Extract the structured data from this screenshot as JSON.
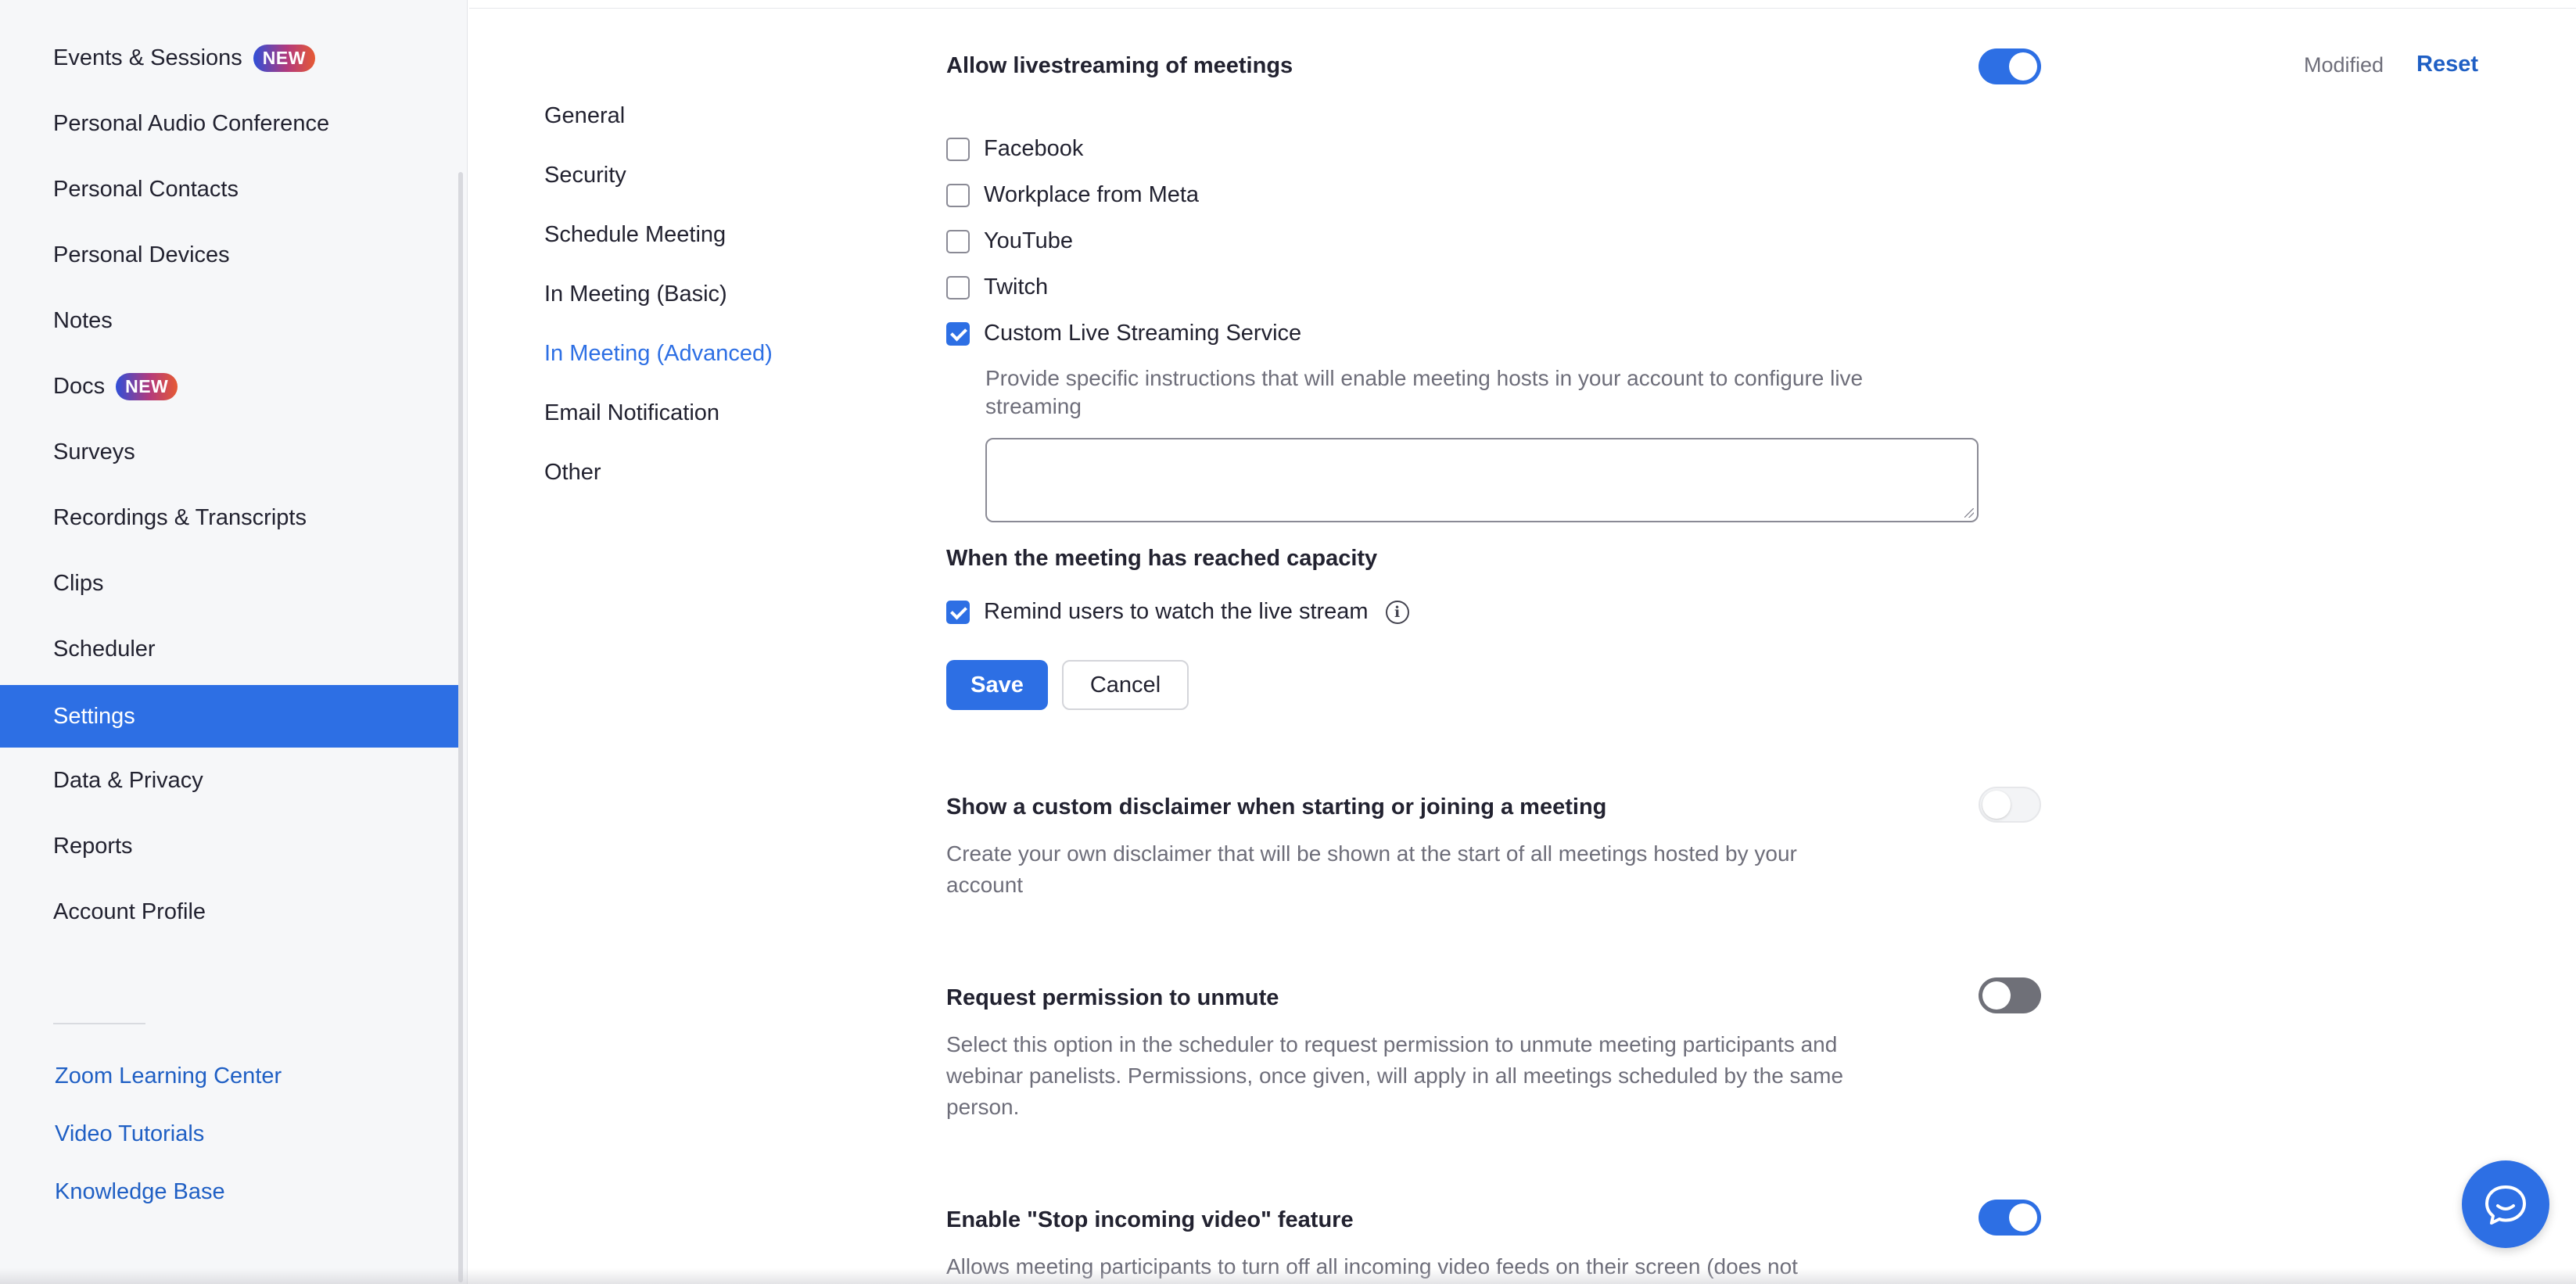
{
  "sidebar": {
    "items": [
      {
        "label": "Events & Sessions",
        "badge": "NEW"
      },
      {
        "label": "Personal Audio Conference"
      },
      {
        "label": "Personal Contacts"
      },
      {
        "label": "Personal Devices"
      },
      {
        "label": "Notes"
      },
      {
        "label": "Docs",
        "badge": "NEW"
      },
      {
        "label": "Surveys"
      },
      {
        "label": "Recordings & Transcripts"
      },
      {
        "label": "Clips"
      },
      {
        "label": "Scheduler"
      },
      {
        "label": "Settings",
        "active": true
      },
      {
        "label": "Data & Privacy"
      },
      {
        "label": "Reports"
      },
      {
        "label": "Account Profile"
      }
    ],
    "links": [
      "Zoom Learning Center",
      "Video Tutorials",
      "Knowledge Base"
    ]
  },
  "subnav": {
    "items": [
      "General",
      "Security",
      "Schedule Meeting",
      "In Meeting (Basic)",
      "In Meeting (Advanced)",
      "Email Notification",
      "Other"
    ],
    "active": "In Meeting (Advanced)"
  },
  "livestream": {
    "title": "Allow livestreaming of meetings",
    "toggle_on": true,
    "status": "Modified",
    "reset_label": "Reset",
    "options": [
      {
        "label": "Facebook",
        "checked": false
      },
      {
        "label": "Workplace from Meta",
        "checked": false
      },
      {
        "label": "YouTube",
        "checked": false
      },
      {
        "label": "Twitch",
        "checked": false
      },
      {
        "label": "Custom Live Streaming Service",
        "checked": true
      }
    ],
    "custom_instructions_l1": "Provide specific instructions that will enable meeting hosts in your account to configure live",
    "custom_instructions_l2": "streaming",
    "instructions_value": "",
    "capacity_title": "When the meeting has reached capacity",
    "remind_label": "Remind users to watch the live stream",
    "remind_checked": true,
    "save_label": "Save",
    "cancel_label": "Cancel"
  },
  "disclaimer": {
    "title": "Show a custom disclaimer when starting or joining a meeting",
    "desc_l1": "Create your own disclaimer that will be shown at the start of all meetings hosted by your",
    "desc_l2": "account",
    "toggle_on": false
  },
  "unmute": {
    "title": "Request permission to unmute",
    "desc_l1": "Select this option in the scheduler to request permission to unmute meeting participants and",
    "desc_l2": "webinar panelists. Permissions, once given, will apply in all meetings scheduled by the same",
    "desc_l3": "person.",
    "toggle_on": false
  },
  "stop_video": {
    "title": "Enable \"Stop incoming video\" feature",
    "desc_l1": "Allows meeting participants to turn off all incoming video feeds on their screen (does not",
    "toggle_on": true
  },
  "colors": {
    "accent": "#2d6fe4",
    "link": "#1f5fc4"
  }
}
